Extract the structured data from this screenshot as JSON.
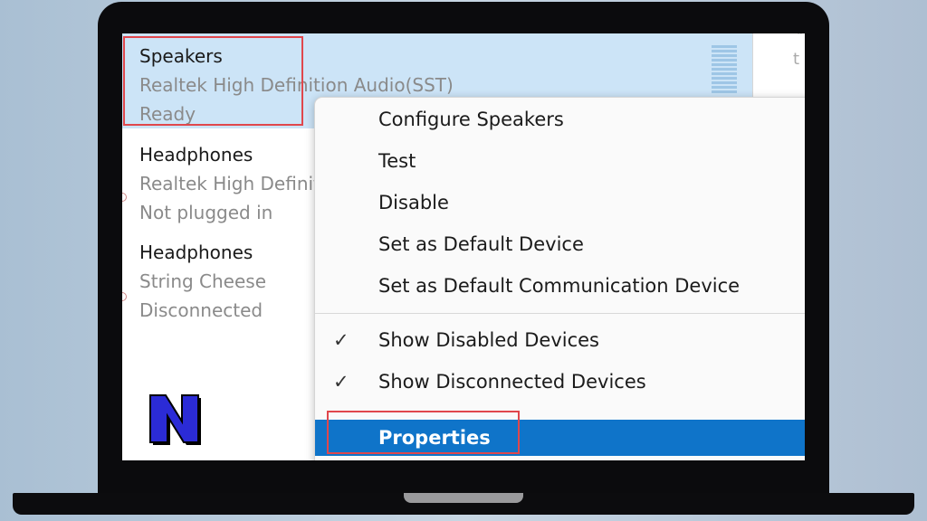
{
  "devices": [
    {
      "name": "Speakers",
      "driver": "Realtek High Definition Audio(SST)",
      "status": "Ready"
    },
    {
      "name": "Headphones",
      "driver": "Realtek High Definit",
      "status": "Not plugged in"
    },
    {
      "name": "Headphones",
      "driver": "String Cheese",
      "status": "Disconnected"
    }
  ],
  "right_panel_fragment": "t",
  "context_menu": {
    "items": [
      {
        "label": "Configure Speakers"
      },
      {
        "label": "Test"
      },
      {
        "label": "Disable"
      },
      {
        "label": "Set as Default Device"
      },
      {
        "label": "Set as Default Communication Device"
      },
      {
        "label": "Show Disabled Devices",
        "checked": "✓"
      },
      {
        "label": "Show Disconnected Devices",
        "checked": "✓"
      },
      {
        "label": "Properties"
      }
    ]
  },
  "logo_letter": "N",
  "colors": {
    "selection_bg": "#cce4f7",
    "highlight": "#0f74c9",
    "annotation_red": "#e0474c",
    "logo_blue": "#2b2bd6"
  }
}
